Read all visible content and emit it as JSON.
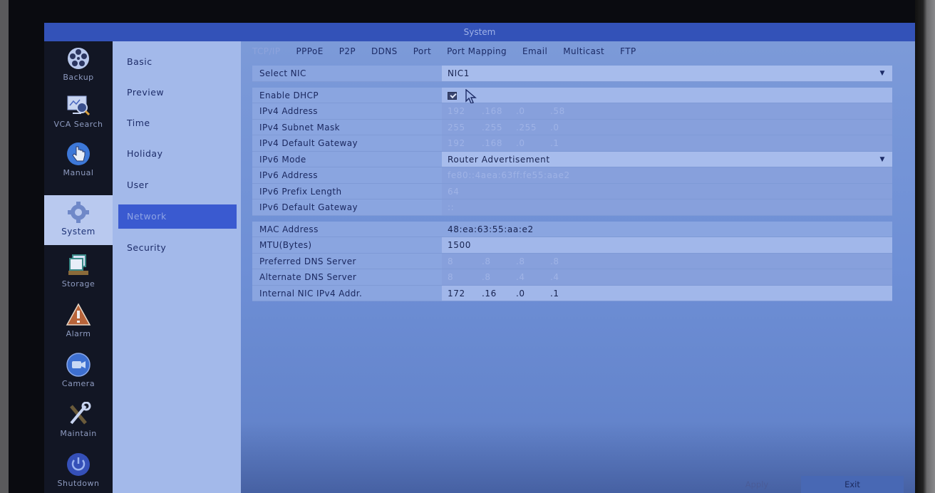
{
  "window": {
    "title": "System"
  },
  "colors": {
    "titlebar": "#3352b8",
    "active_subnav": "#3a5ad0",
    "content_bg": "#7c9ad8",
    "nav_bg": "#121624"
  },
  "left_nav": {
    "items": [
      {
        "label": "Backup",
        "icon": "film-reel-icon",
        "active": false
      },
      {
        "label": "VCA Search",
        "icon": "monitor-search-icon",
        "active": false
      },
      {
        "label": "Manual",
        "icon": "hand-pointer-icon",
        "active": false
      },
      {
        "label": "System",
        "icon": "gear-icon",
        "active": true
      },
      {
        "label": "Storage",
        "icon": "storage-windows-icon",
        "active": false
      },
      {
        "label": "Alarm",
        "icon": "warning-triangle-icon",
        "active": false
      },
      {
        "label": "Camera",
        "icon": "camera-icon",
        "active": false
      },
      {
        "label": "Maintain",
        "icon": "wrench-screwdriver-icon",
        "active": false
      },
      {
        "label": "Shutdown",
        "icon": "power-icon",
        "active": false
      }
    ]
  },
  "sub_nav": {
    "items": [
      {
        "label": "Basic",
        "active": false
      },
      {
        "label": "Preview",
        "active": false
      },
      {
        "label": "Time",
        "active": false
      },
      {
        "label": "Holiday",
        "active": false
      },
      {
        "label": "User",
        "active": false
      },
      {
        "label": "Network",
        "active": true
      },
      {
        "label": "Security",
        "active": false
      }
    ]
  },
  "tabs": [
    {
      "label": "TCP/IP",
      "active": true
    },
    {
      "label": "PPPoE",
      "active": false
    },
    {
      "label": "P2P",
      "active": false
    },
    {
      "label": "DDNS",
      "active": false
    },
    {
      "label": "Port",
      "active": false
    },
    {
      "label": "Port Mapping",
      "active": false
    },
    {
      "label": "Email",
      "active": false
    },
    {
      "label": "Multicast",
      "active": false
    },
    {
      "label": "FTP",
      "active": false
    }
  ],
  "form": {
    "select_nic": {
      "label": "Select NIC",
      "value": "NIC1"
    },
    "enable_dhcp": {
      "label": "Enable DHCP",
      "checked": true
    },
    "ipv4_address": {
      "label": "IPv4 Address",
      "octets": [
        "192",
        ".168",
        ".0",
        ".58"
      ]
    },
    "ipv4_subnet_mask": {
      "label": "IPv4 Subnet Mask",
      "octets": [
        "255",
        ".255",
        ".255",
        ".0"
      ]
    },
    "ipv4_default_gateway": {
      "label": "IPv4 Default Gateway",
      "octets": [
        "192",
        ".168",
        ".0",
        ".1"
      ]
    },
    "ipv6_mode": {
      "label": "IPv6 Mode",
      "value": "Router Advertisement"
    },
    "ipv6_address": {
      "label": "IPv6 Address",
      "value": "fe80::4aea:63ff:fe55:aae2"
    },
    "ipv6_prefix_length": {
      "label": "IPv6 Prefix Length",
      "value": "64"
    },
    "ipv6_default_gateway": {
      "label": "IPv6 Default Gateway",
      "value": "::"
    },
    "mac_address": {
      "label": "MAC Address",
      "value": "48:ea:63:55:aa:e2"
    },
    "mtu": {
      "label": "MTU(Bytes)",
      "value": "1500"
    },
    "preferred_dns": {
      "label": "Preferred DNS Server",
      "octets": [
        "8",
        ".8",
        ".8",
        ".8"
      ]
    },
    "alternate_dns": {
      "label": "Alternate DNS Server",
      "octets": [
        "8",
        ".8",
        ".4",
        ".4"
      ]
    },
    "internal_nic_ipv4": {
      "label": "Internal NIC IPv4 Addr.",
      "octets": [
        "172",
        ".16",
        ".0",
        ".1"
      ]
    }
  },
  "footer": {
    "apply_label": "Apply",
    "exit_label": "Exit"
  }
}
